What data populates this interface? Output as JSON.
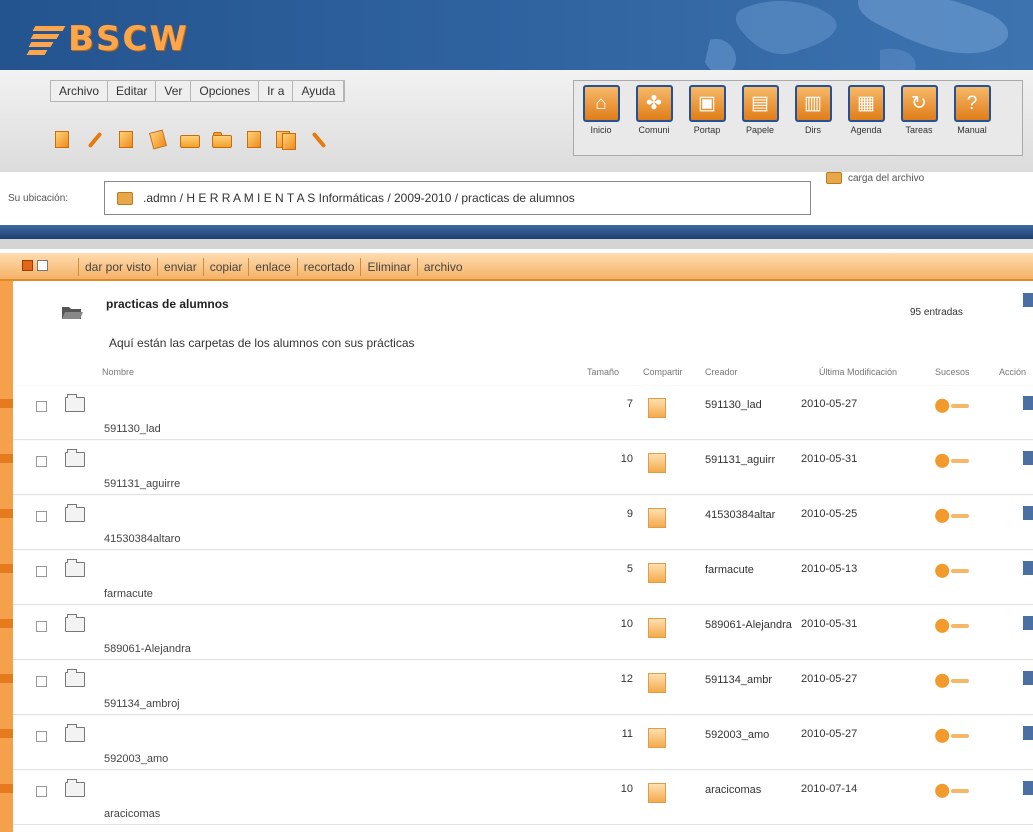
{
  "header": {
    "logo_text": "BSCW"
  },
  "menu": [
    {
      "label": "Archivo"
    },
    {
      "label": "Editar"
    },
    {
      "label": "Ver"
    },
    {
      "label": "Opciones"
    },
    {
      "label": "Ir a"
    },
    {
      "label": "Ayuda"
    }
  ],
  "action_icons": [
    "new-document-icon",
    "edit-icon",
    "copy-icon",
    "move-icon",
    "mail-icon",
    "folder-icon",
    "document-icon",
    "documents-icon",
    "link-icon"
  ],
  "nav_buttons": [
    {
      "label": "Inicio",
      "icon": "home-icon",
      "glyph": "⌂"
    },
    {
      "label": "Comuni",
      "icon": "community-icon",
      "glyph": "✤"
    },
    {
      "label": "Portap",
      "icon": "clipboard-icon",
      "glyph": "▣"
    },
    {
      "label": "Papele",
      "icon": "wastebasket-icon",
      "glyph": "▤"
    },
    {
      "label": "Dirs",
      "icon": "address-book-icon",
      "glyph": "▥"
    },
    {
      "label": "Agenda",
      "icon": "calendar-icon",
      "glyph": "▦"
    },
    {
      "label": "Tareas",
      "icon": "tasks-icon",
      "glyph": "↻"
    },
    {
      "label": "Manual",
      "icon": "manual-icon",
      "glyph": "?"
    }
  ],
  "location": {
    "label": "Su ubicación:",
    "path": ".admn / H E R R A M I E N T A S Informáticas / 2009-2010 / practicas de alumnos"
  },
  "upload": {
    "label": "carga del archivo"
  },
  "operations": [
    {
      "label": "dar por visto"
    },
    {
      "label": "enviar"
    },
    {
      "label": "copiar"
    },
    {
      "label": "enlace"
    },
    {
      "label": "recortado"
    },
    {
      "label": "Eliminar"
    },
    {
      "label": "archivo"
    }
  ],
  "folder": {
    "title": "practicas de alumnos",
    "description": "Aquí están las carpetas de los alumnos con sus prácticas",
    "entries": "95 entradas"
  },
  "columns": {
    "name": "Nombre",
    "size": "Tamaño",
    "shared": "Compartir",
    "creator": "Creador",
    "modified": "Última Modificación",
    "events": "Sucesos",
    "actions": "Acción"
  },
  "rows": [
    {
      "name": "591130_lad",
      "size": "7",
      "creator": "591130_lad",
      "date": "2010-05-27"
    },
    {
      "name": "591131_aguirre",
      "size": "10",
      "creator": "591131_aguirr",
      "date": "2010-05-31"
    },
    {
      "name": "41530384altaro",
      "size": "9",
      "creator": "41530384altar",
      "date": "2010-05-25"
    },
    {
      "name": "farmacute",
      "size": "5",
      "creator": "farmacute",
      "date": "2010-05-13"
    },
    {
      "name": "589061-Alejandra",
      "size": "10",
      "creator": "589061-Alejandra",
      "date": "2010-05-31",
      "wrap": true
    },
    {
      "name": "591134_ambroj",
      "size": "12",
      "creator": "591134_ambr",
      "date": "2010-05-27"
    },
    {
      "name": "592003_amo",
      "size": "11",
      "creator": "592003_amo",
      "date": "2010-05-27"
    },
    {
      "name": "aracicomas",
      "size": "10",
      "creator": "aracicomas",
      "date": "2010-07-14"
    }
  ],
  "colors": {
    "header_blue": "#2f63a0",
    "accent_orange": "#f5a04a",
    "op_bar": "#f5b266"
  }
}
